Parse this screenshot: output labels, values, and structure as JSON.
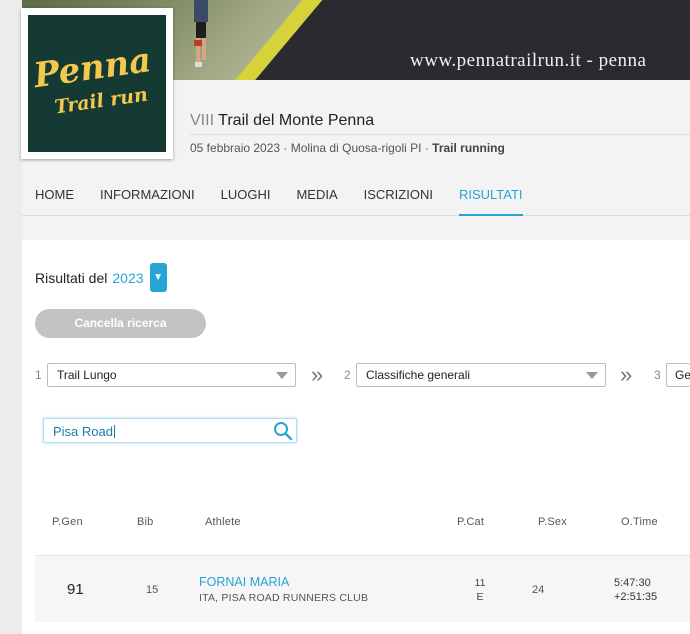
{
  "banner": {
    "url_text": "www.pennatrailrun.it  -  penna"
  },
  "logo": {
    "line1": "Penna",
    "line2": "Trail run"
  },
  "event": {
    "edition": "VIII",
    "name": "Trail del Monte Penna",
    "date": "05 febbraio 2023",
    "location": "Molina di Quosa-rigoli PI",
    "discipline": "Trail running",
    "separator": " · "
  },
  "nav": {
    "items": [
      {
        "label": "HOME"
      },
      {
        "label": "INFORMAZIONI"
      },
      {
        "label": "LUOGHI"
      },
      {
        "label": "MEDIA"
      },
      {
        "label": "ISCRIZIONI"
      },
      {
        "label": "RISULTATI",
        "active": true
      }
    ]
  },
  "results": {
    "heading": "Risultati del",
    "year": "2023",
    "clear_button": "Cancella ricerca",
    "steps": [
      {
        "number": "1",
        "value": "Trail Lungo"
      },
      {
        "number": "2",
        "value": "Classifiche generali"
      },
      {
        "number": "3",
        "value": "Ge"
      }
    ],
    "search": {
      "value": "Pisa Road"
    },
    "columns": [
      "P.Gen",
      "Bib",
      "Athlete",
      "P.Cat",
      "P.Sex",
      "O.Time"
    ],
    "rows": [
      {
        "pgen": "91",
        "bib": "15",
        "athlete": "FORNAI MARIA",
        "club": "ITA, PISA ROAD RUNNERS CLUB",
        "pcat_line1": "11",
        "pcat_line2": "E",
        "psex": "24",
        "time": "5:47:30",
        "gap": "+2:51:35"
      }
    ]
  },
  "colors": {
    "accent": "#27a4d6",
    "logo_bg": "#143a33",
    "logo_text": "#f2c94c",
    "banner_stripe": "#d8d23a"
  }
}
